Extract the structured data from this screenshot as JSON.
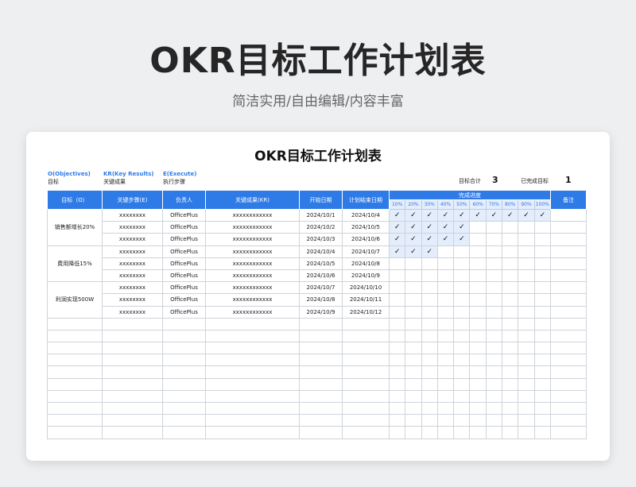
{
  "hero": {
    "title": "OKR目标工作计划表",
    "subtitle": "简洁实用/自由编辑/内容丰富"
  },
  "sheet": {
    "title": "OKR目标工作计划表",
    "legend": [
      {
        "head": "O(Objectives)",
        "desc": "目标"
      },
      {
        "head": "KR(Key Results)",
        "desc": "关键成果"
      },
      {
        "head": "E(Execute)",
        "desc": "执行步骤"
      }
    ],
    "stats": {
      "total_label": "目标合计",
      "total_value": "3",
      "done_label": "已完成目标",
      "done_value": "1"
    },
    "headers": {
      "goal": "目标（O）",
      "step": "关键步骤(E)",
      "owner": "负责人",
      "kr": "关键成果(KR)",
      "start": "开始日期",
      "end": "计划结束日期",
      "progress": "完成进度",
      "note": "备注",
      "percents": [
        "10%",
        "20%",
        "30%",
        "40%",
        "50%",
        "60%",
        "70%",
        "80%",
        "90%",
        "100%"
      ]
    },
    "check_mark": "✓",
    "groups": [
      {
        "goal": "销售额增长20%",
        "rows": [
          {
            "step": "xxxxxxxx",
            "owner": "OfficePlus",
            "kr": "xxxxxxxxxxxx",
            "start": "2024/10/1",
            "end": "2024/10/4",
            "progress": 10
          },
          {
            "step": "xxxxxxxx",
            "owner": "OfficePlus",
            "kr": "xxxxxxxxxxxx",
            "start": "2024/10/2",
            "end": "2024/10/5",
            "progress": 5
          },
          {
            "step": "xxxxxxxx",
            "owner": "OfficePlus",
            "kr": "xxxxxxxxxxxx",
            "start": "2024/10/3",
            "end": "2024/10/6",
            "progress": 5
          }
        ]
      },
      {
        "goal": "费用降低15%",
        "rows": [
          {
            "step": "xxxxxxxx",
            "owner": "OfficePlus",
            "kr": "xxxxxxxxxxxx",
            "start": "2024/10/4",
            "end": "2024/10/7",
            "progress": 3
          },
          {
            "step": "xxxxxxxx",
            "owner": "OfficePlus",
            "kr": "xxxxxxxxxxxx",
            "start": "2024/10/5",
            "end": "2024/10/8",
            "progress": 0
          },
          {
            "step": "xxxxxxxx",
            "owner": "OfficePlus",
            "kr": "xxxxxxxxxxxx",
            "start": "2024/10/6",
            "end": "2024/10/9",
            "progress": 0
          }
        ]
      },
      {
        "goal": "利润实现500W",
        "rows": [
          {
            "step": "xxxxxxxx",
            "owner": "OfficePlus",
            "kr": "xxxxxxxxxxxx",
            "start": "2024/10/7",
            "end": "2024/10/10",
            "progress": 0
          },
          {
            "step": "xxxxxxxx",
            "owner": "OfficePlus",
            "kr": "xxxxxxxxxxxx",
            "start": "2024/10/8",
            "end": "2024/10/11",
            "progress": 0
          },
          {
            "step": "xxxxxxxx",
            "owner": "OfficePlus",
            "kr": "xxxxxxxxxxxx",
            "start": "2024/10/9",
            "end": "2024/10/12",
            "progress": 0
          }
        ]
      }
    ],
    "blank_row_count": 10
  }
}
